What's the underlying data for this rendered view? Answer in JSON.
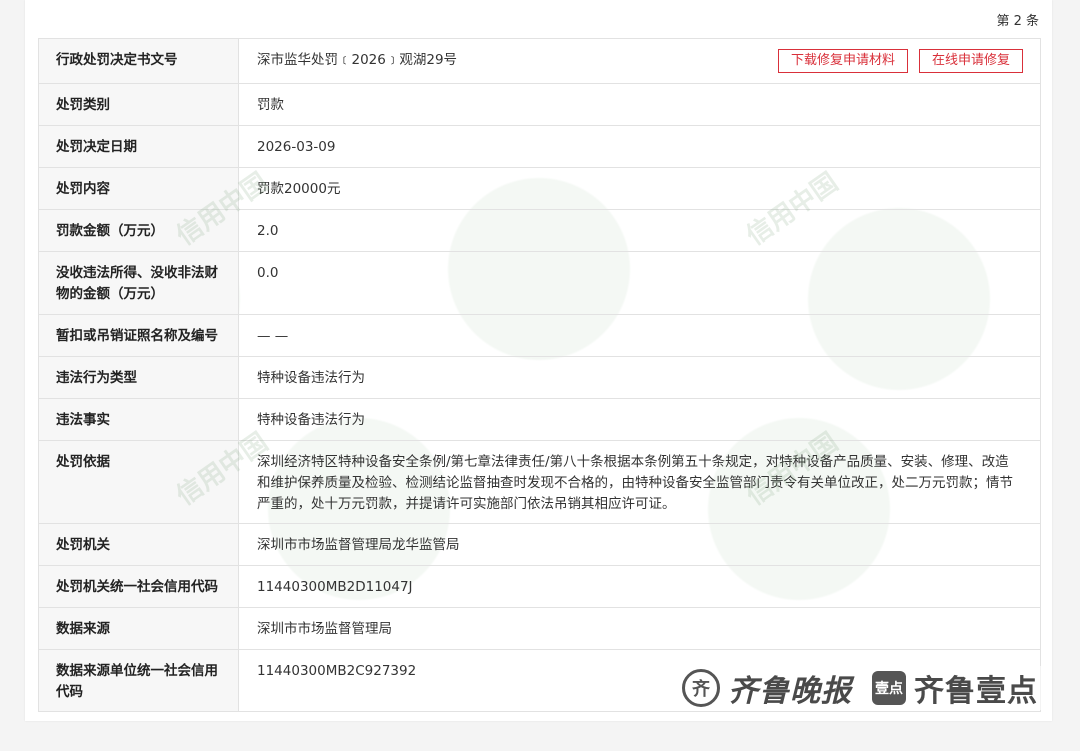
{
  "counter": "第 2 条",
  "buttons": {
    "download": "下载修复申请材料",
    "online": "在线申请修复"
  },
  "rows": [
    {
      "label": "行政处罚决定书文号",
      "value": "深市监华处罚﹝2026﹞观湖29号"
    },
    {
      "label": "处罚类别",
      "value": "罚款"
    },
    {
      "label": "处罚决定日期",
      "value": "2026-03-09"
    },
    {
      "label": "处罚内容",
      "value": "罚款20000元"
    },
    {
      "label": "罚款金额（万元）",
      "value": "2.0"
    },
    {
      "label": "没收违法所得、没收非法财物的金额（万元）",
      "value": "0.0"
    },
    {
      "label": "暂扣或吊销证照名称及编号",
      "value": "— —"
    },
    {
      "label": "违法行为类型",
      "value": "特种设备违法行为"
    },
    {
      "label": "违法事实",
      "value": "特种设备违法行为"
    },
    {
      "label": "处罚依据",
      "value": "深圳经济特区特种设备安全条例/第七章法律责任/第八十条根据本条例第五十条规定，对特种设备产品质量、安装、修理、改造和维护保养质量及检验、检测结论监督抽查时发现不合格的，由特种设备安全监管部门责令有关单位改正，处二万元罚款；情节严重的，处十万元罚款，并提请许可实施部门依法吊销其相应许可证。"
    },
    {
      "label": "处罚机关",
      "value": "深圳市市场监督管理局龙华监管局"
    },
    {
      "label": "处罚机关统一社会信用代码",
      "value": "11440300MB2D11047J"
    },
    {
      "label": "数据来源",
      "value": "深圳市市场监督管理局"
    },
    {
      "label": "数据来源单位统一社会信用代码",
      "value": "11440300MB2C927392"
    }
  ],
  "watermark": "信用中国",
  "brand": {
    "seal": "齐",
    "name": "齐鲁晚报",
    "box": "壹点",
    "name2": "齐鲁壹点"
  }
}
